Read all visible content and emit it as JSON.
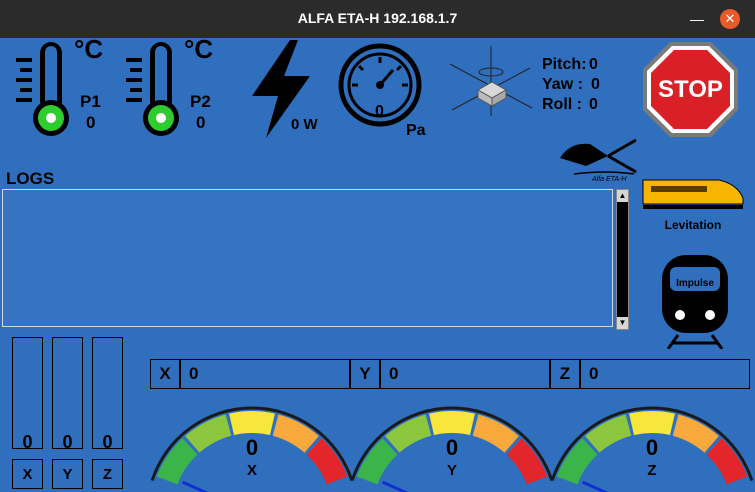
{
  "window": {
    "title": "ALFA ETA-H 192.168.1.7",
    "minimize_icon": "minimize-icon",
    "close_icon": "close-icon"
  },
  "sensors": {
    "temp1": {
      "unit": "°C",
      "label": "P1",
      "value": "0"
    },
    "temp2": {
      "unit": "°C",
      "label": "P2",
      "value": "0"
    },
    "power": {
      "value": "0 W"
    },
    "pressure": {
      "value": "0",
      "unit": "Pa"
    },
    "orientation": {
      "pitch_label": "Pitch:",
      "pitch_value": "0",
      "yaw_label": "Yaw  :",
      "yaw_value": "0",
      "roll_label": "Roll  :",
      "roll_value": "0"
    }
  },
  "stop_button": {
    "label": "STOP",
    "color": "#d92027"
  },
  "logo": {
    "caption": "Alfa ETA-H"
  },
  "levitation": {
    "label": "Levitation"
  },
  "impulse": {
    "label": "Impulse"
  },
  "logs": {
    "title": "LOGS"
  },
  "bars": [
    {
      "axis": "X",
      "value": "0"
    },
    {
      "axis": "Y",
      "value": "0"
    },
    {
      "axis": "Z",
      "value": "0"
    }
  ],
  "fields": [
    {
      "key": "X",
      "value": "0"
    },
    {
      "key": "Y",
      "value": "0"
    },
    {
      "key": "Z",
      "value": "0"
    }
  ],
  "gauges": [
    {
      "axis": "X",
      "value": "0"
    },
    {
      "axis": "Y",
      "value": "0"
    },
    {
      "axis": "Z",
      "value": "0"
    }
  ],
  "colors": {
    "background": "#2f6fbe",
    "thermometer_bulb": "#2ecc2e",
    "gauge_green": "#3bb54a",
    "gauge_lightgreen": "#8cc63f",
    "gauge_yellow": "#f7e63b",
    "gauge_orange": "#f7a93b",
    "gauge_red": "#e2262c"
  }
}
